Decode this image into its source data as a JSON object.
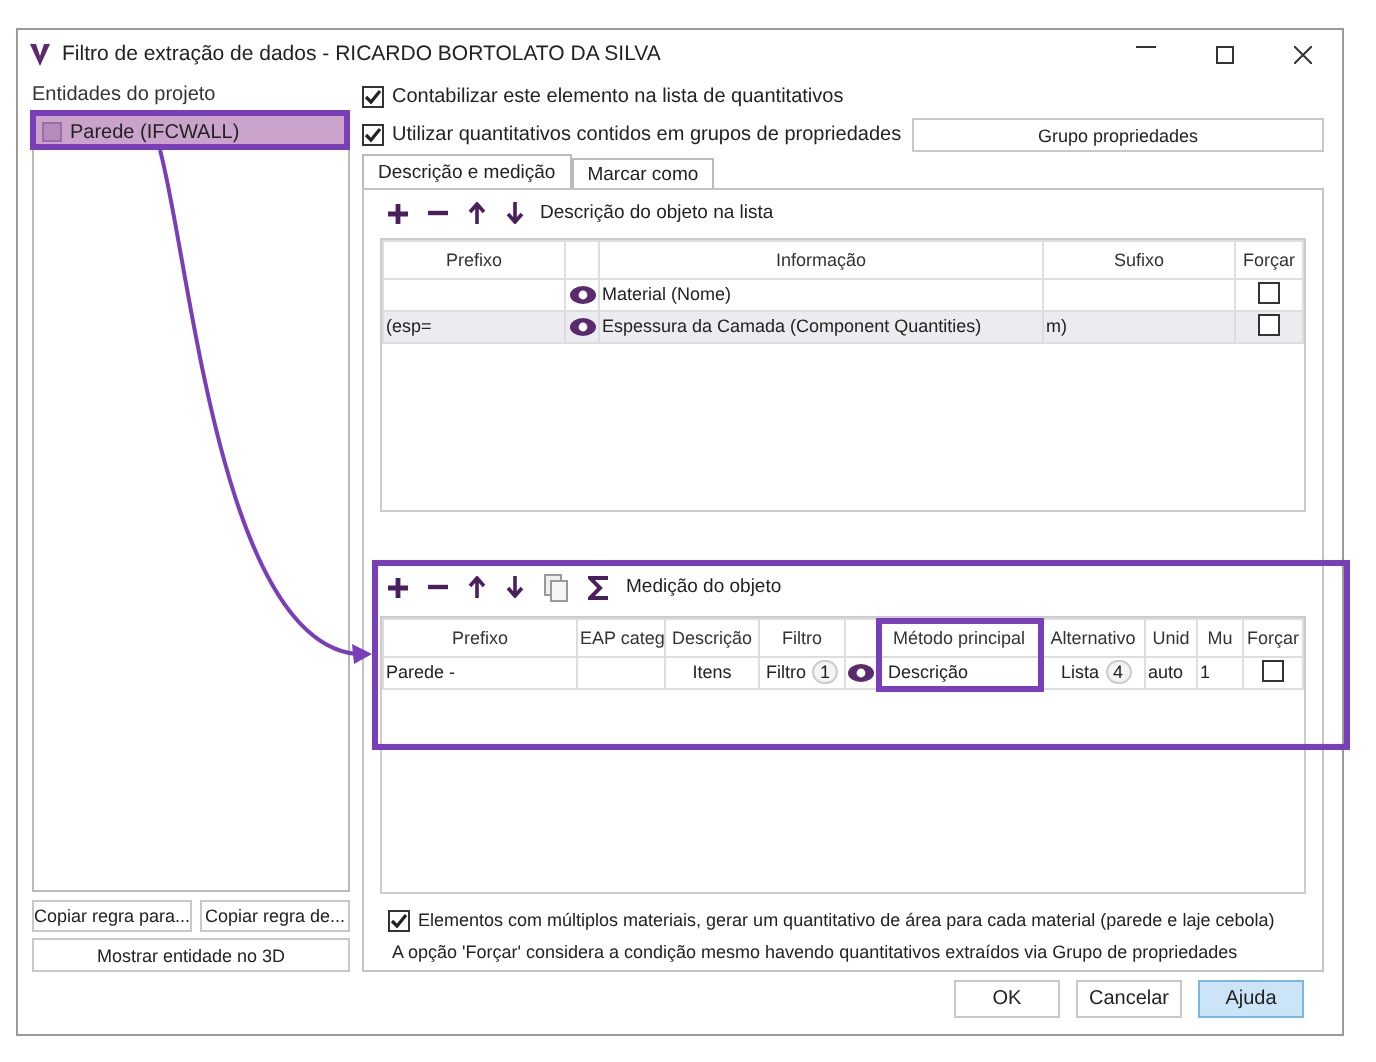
{
  "window": {
    "title": "Filtro de extração de dados - RICARDO BORTOLATO DA SILVA"
  },
  "entities": {
    "label": "Entidades do projeto",
    "items": [
      {
        "label": "Parede (IFCWALL)",
        "selected": true
      }
    ],
    "buttons": [
      "Copiar regra para...",
      "Copiar regra de..."
    ],
    "show_button": "Mostrar entidade no 3D"
  },
  "options": [
    {
      "label": "Contabilizar este elemento na lista de quantitativos",
      "checked": true
    },
    {
      "label": "Utilizar quantitativos contidos em grupos de propriedades",
      "checked": true
    }
  ],
  "group_button": "Grupo propriedades",
  "tabs": [
    {
      "label": "Descrição e medição",
      "selected": true
    },
    {
      "label": "Marcar como",
      "selected": false
    }
  ],
  "description": {
    "toolbar_label": "Descrição do objeto na lista",
    "columns": [
      "Prefixo",
      "Informação",
      "Sufixo",
      "Forçar"
    ],
    "rows": [
      {
        "prefix": "",
        "info": "Material (Nome)",
        "suffix": "",
        "force": false,
        "selected": false
      },
      {
        "prefix": "(esp=",
        "info": "Espessura da Camada (Component Quantities)",
        "suffix": "m)",
        "force": false,
        "selected": true
      }
    ]
  },
  "measurement": {
    "toolbar_label": "Medição do objeto",
    "columns": [
      "Prefixo",
      "EAP categ",
      "Descrição",
      "Filtro",
      "Método principal",
      "Alternativo",
      "Unid",
      "Mu",
      "Forçar"
    ],
    "rows": [
      {
        "prefix": "Parede -",
        "description": "Itens",
        "filter": "Filtro",
        "filter_count": "1",
        "method": "Descrição",
        "alternative": "Lista",
        "alternative_count": "4",
        "unit": "auto",
        "multiplier": "1",
        "force": false
      }
    ]
  },
  "multi_material": {
    "label": "Elementos com múltiplos materiais, gerar um quantitativo de área para cada material (parede e laje cebola)",
    "checked": true
  },
  "note": "A opção 'Forçar' considera a condição mesmo havendo quantitativos extraídos via Grupo de propriedades",
  "buttons": [
    {
      "label": "OK",
      "focused": false
    },
    {
      "label": "Cancelar",
      "focused": false
    },
    {
      "label": "Ajuda",
      "focused": true
    }
  ]
}
